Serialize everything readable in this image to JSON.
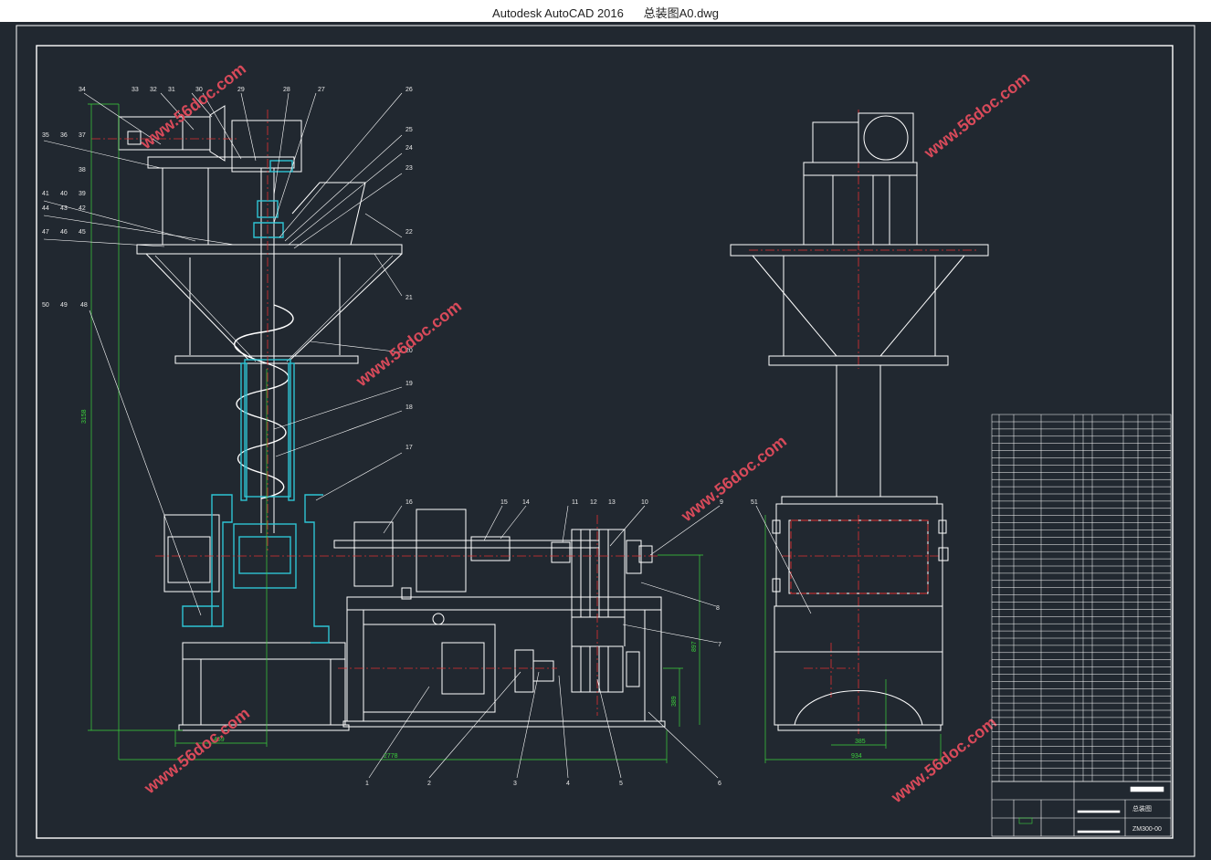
{
  "window": {
    "app_name": "Autodesk AutoCAD 2016",
    "file_name": "总装图A0.dwg"
  },
  "drawing": {
    "part_labels_left": [
      "34",
      "33",
      "32",
      "31",
      "30",
      "29",
      "28",
      "27",
      "26",
      "35",
      "36",
      "37",
      "38",
      "39",
      "40",
      "41",
      "42",
      "43",
      "44",
      "45",
      "46",
      "47",
      "25",
      "24",
      "23",
      "22",
      "21",
      "20",
      "19",
      "18",
      "17",
      "48",
      "49",
      "50",
      "16",
      "15",
      "14",
      "13",
      "12",
      "11",
      "10",
      "9",
      "8",
      "7",
      "6",
      "5",
      "4",
      "3",
      "2",
      "1"
    ],
    "part_label_right": "51",
    "dimensions": {
      "overall_height": "3158",
      "base_width": "2778",
      "left_offset": "459",
      "motor_height": "389",
      "frame_height": "897",
      "side_width": "934",
      "side_inner": "385"
    },
    "watermark": "www.56doc.com",
    "title_block": {
      "drawing_name": "总装图",
      "drawing_code": "ZM300-00"
    },
    "colors": {
      "background": "#212830",
      "lines": "#ffffff",
      "section": "#2ec4d4",
      "center_lines": "#e03030",
      "dimensions": "#3cd23c",
      "watermark": "#d84a5a"
    }
  }
}
